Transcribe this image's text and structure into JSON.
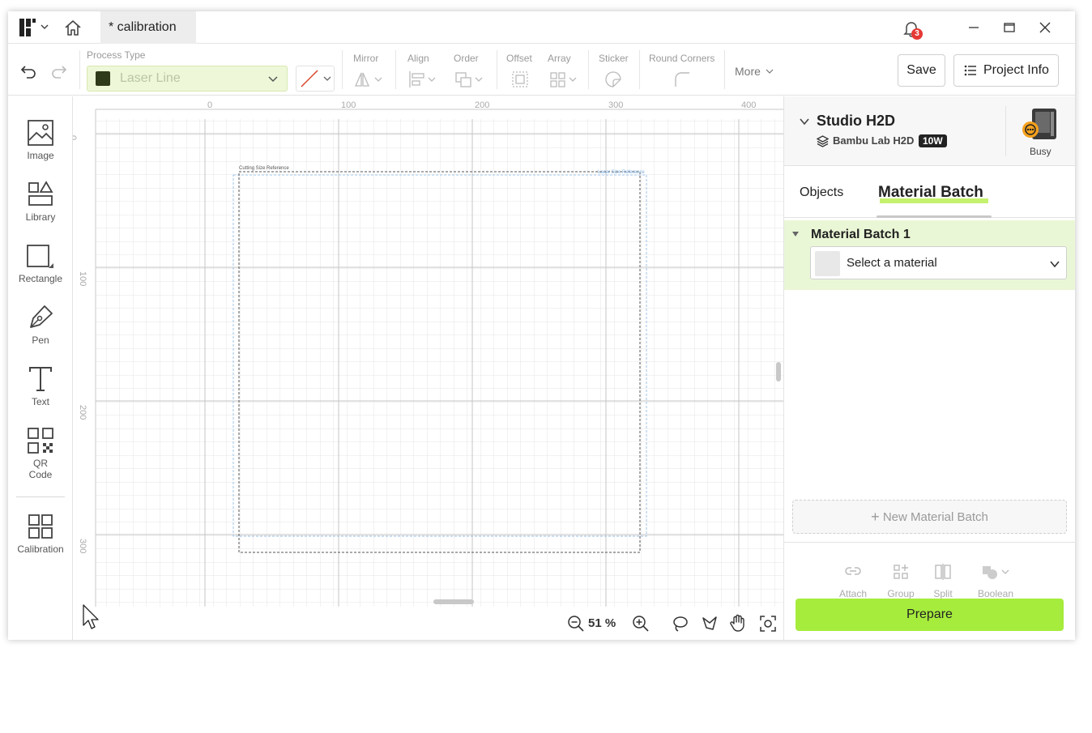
{
  "titlebar": {
    "tab_title": "* calibration",
    "notification_count": "3"
  },
  "toolbar": {
    "process_type_label": "Process Type",
    "process_type_value": "Laser Line",
    "mirror_label": "Mirror",
    "align_label": "Align",
    "order_label": "Order",
    "offset_label": "Offset",
    "array_label": "Array",
    "sticker_label": "Sticker",
    "round_corners_label": "Round Corners",
    "more_label": "More",
    "save_label": "Save",
    "project_info_label": "Project Info"
  },
  "sidebar": {
    "tools": [
      {
        "label": "Image"
      },
      {
        "label": "Library"
      },
      {
        "label": "Rectangle"
      },
      {
        "label": "Pen"
      },
      {
        "label": "Text"
      },
      {
        "label": "QR\nCode"
      },
      {
        "label": "Calibration"
      }
    ]
  },
  "canvas": {
    "ruler_top": [
      "0",
      "100",
      "200",
      "300",
      "400"
    ],
    "ruler_left": [
      "0",
      "100",
      "200",
      "300"
    ],
    "cutting_ref_label": "Cutting Size Reference",
    "laser_ref_label": "Laser Size Reference",
    "zoom": "51 %"
  },
  "device": {
    "name": "Studio H2D",
    "model": "Bambu Lab H2D",
    "power_badge": "10W",
    "status": "Busy"
  },
  "panel": {
    "tabs": [
      "Objects",
      "Material Batch"
    ],
    "batch_title": "Material Batch 1",
    "material_placeholder": "Select a material",
    "new_batch_label": "New Material Batch",
    "actions": [
      "Attach",
      "Group",
      "Split",
      "Boolean"
    ],
    "prepare_label": "Prepare"
  },
  "colors": {
    "accent": "#a6ec3c",
    "batch_bg": "#eaf7d6",
    "badge": "#e53935"
  }
}
